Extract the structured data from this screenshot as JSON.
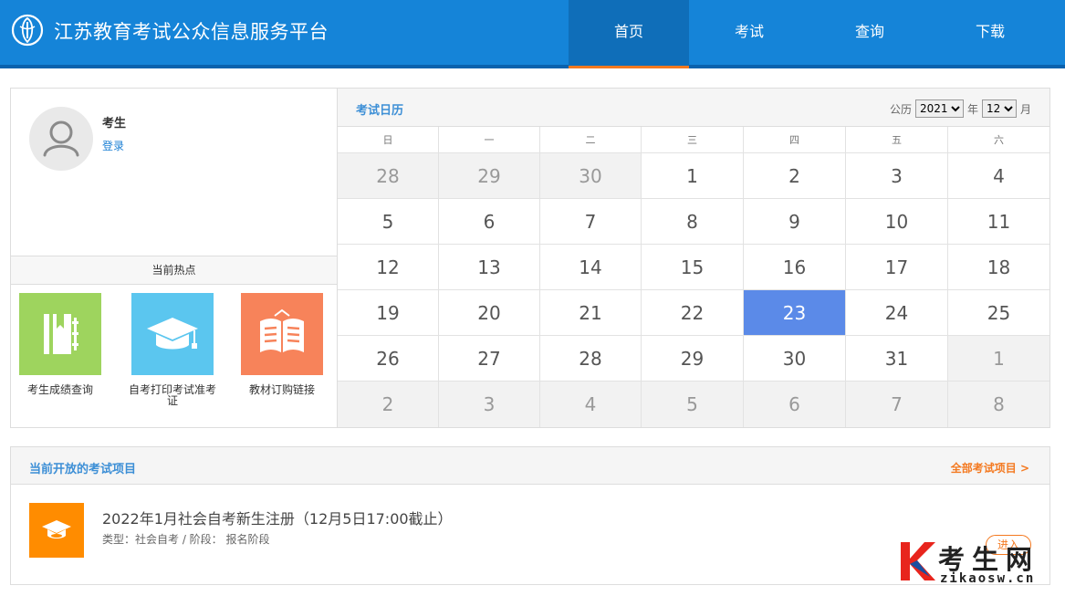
{
  "header": {
    "site_title": "江苏教育考试公众信息服务平台",
    "nav": [
      {
        "label": "首页",
        "active": true
      },
      {
        "label": "考试",
        "active": false
      },
      {
        "label": "查询",
        "active": false
      },
      {
        "label": "下载",
        "active": false
      }
    ]
  },
  "user": {
    "name": "考生",
    "login_label": "登录"
  },
  "hot": {
    "title": "当前热点",
    "items": [
      {
        "label": "考生成绩查询",
        "icon": "notebook-icon",
        "color": "#9ed45e"
      },
      {
        "label": "自考打印考试准考证",
        "icon": "graduation-cap-icon",
        "color": "#5bc6ef"
      },
      {
        "label": "教材订购链接",
        "icon": "open-book-icon",
        "color": "#f7835a"
      }
    ]
  },
  "calendar": {
    "title": "考试日历",
    "calendar_label": "公历",
    "year": "2021",
    "year_suffix": "年",
    "month": "12",
    "month_suffix": "月",
    "weekdays": [
      "日",
      "一",
      "二",
      "三",
      "四",
      "五",
      "六"
    ],
    "days": [
      {
        "d": "28",
        "other": true
      },
      {
        "d": "29",
        "other": true
      },
      {
        "d": "30",
        "other": true
      },
      {
        "d": "1"
      },
      {
        "d": "2"
      },
      {
        "d": "3"
      },
      {
        "d": "4"
      },
      {
        "d": "5"
      },
      {
        "d": "6"
      },
      {
        "d": "7"
      },
      {
        "d": "8"
      },
      {
        "d": "9"
      },
      {
        "d": "10"
      },
      {
        "d": "11"
      },
      {
        "d": "12"
      },
      {
        "d": "13"
      },
      {
        "d": "14"
      },
      {
        "d": "15"
      },
      {
        "d": "16"
      },
      {
        "d": "17"
      },
      {
        "d": "18"
      },
      {
        "d": "19"
      },
      {
        "d": "20"
      },
      {
        "d": "21"
      },
      {
        "d": "22"
      },
      {
        "d": "23",
        "today": true
      },
      {
        "d": "24"
      },
      {
        "d": "25"
      },
      {
        "d": "26"
      },
      {
        "d": "27"
      },
      {
        "d": "28"
      },
      {
        "d": "29"
      },
      {
        "d": "30"
      },
      {
        "d": "31"
      },
      {
        "d": "1",
        "other": true
      },
      {
        "d": "2",
        "other": true
      },
      {
        "d": "3",
        "other": true
      },
      {
        "d": "4",
        "other": true
      },
      {
        "d": "5",
        "other": true
      },
      {
        "d": "6",
        "other": true
      },
      {
        "d": "7",
        "other": true
      },
      {
        "d": "8",
        "other": true
      }
    ]
  },
  "projects": {
    "title": "当前开放的考试项目",
    "all_label": "全部考试项目 >",
    "item": {
      "name": "2022年1月社会自考新生注册（12月5日17:00截止）",
      "meta": "类型：社会自考 / 阶段： 报名阶段",
      "enter_label": "进入",
      "icon": "graduation-cap-icon"
    }
  },
  "watermark": {
    "brand_letter": "K",
    "brand_text": "考生网",
    "brand_url": "zikaosw.cn"
  },
  "colors": {
    "header": "#1584d8",
    "accent": "#f47920",
    "today": "#5b8ae8"
  }
}
